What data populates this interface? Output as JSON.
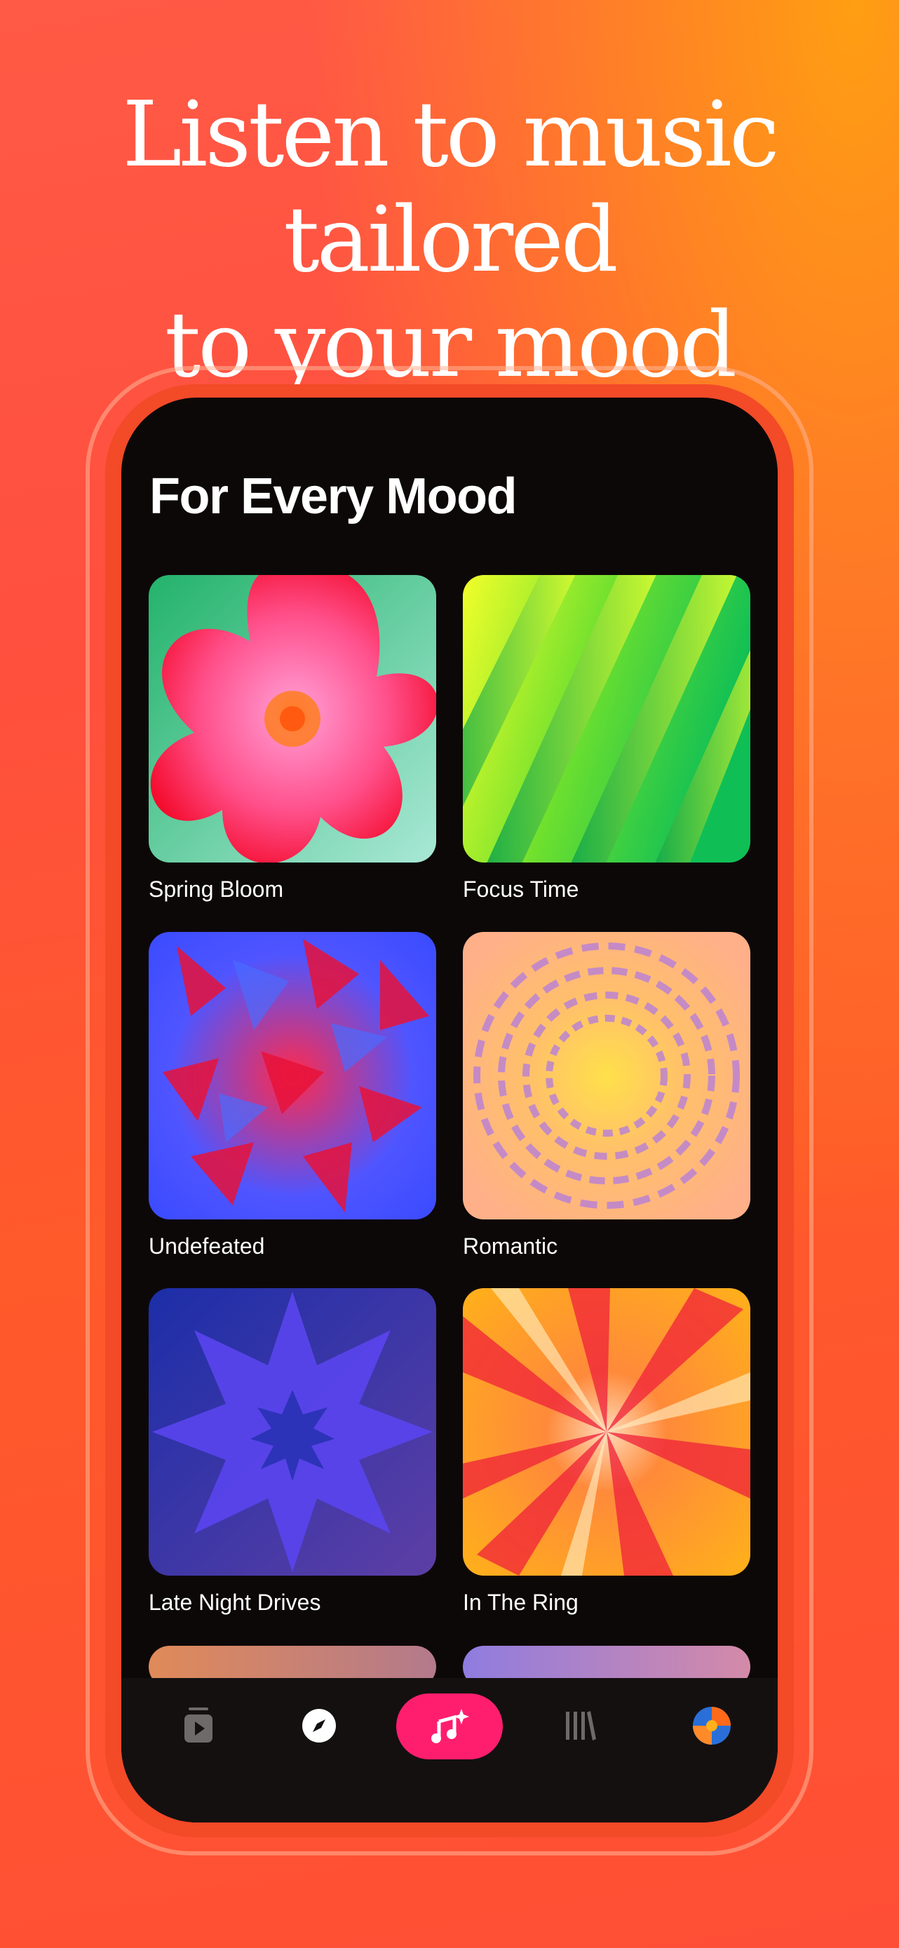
{
  "headline": {
    "line1": "Listen to music tailored",
    "line2": "to your mood"
  },
  "screen": {
    "section_title": "For Every Mood"
  },
  "moods": [
    {
      "title": "Spring Bloom"
    },
    {
      "title": "Focus Time"
    },
    {
      "title": "Undefeated"
    },
    {
      "title": "Romantic"
    },
    {
      "title": "Late Night Drives"
    },
    {
      "title": "In The Ring"
    }
  ],
  "tab_bar": {
    "items": [
      {
        "icon": "now-playing-icon",
        "active": false
      },
      {
        "icon": "compass-icon",
        "active": false
      },
      {
        "icon": "ai-music-icon",
        "active": true
      },
      {
        "icon": "library-icon",
        "active": false
      },
      {
        "icon": "profile-avatar-icon",
        "active": false
      }
    ],
    "accent_color": "#ff1e6e"
  }
}
